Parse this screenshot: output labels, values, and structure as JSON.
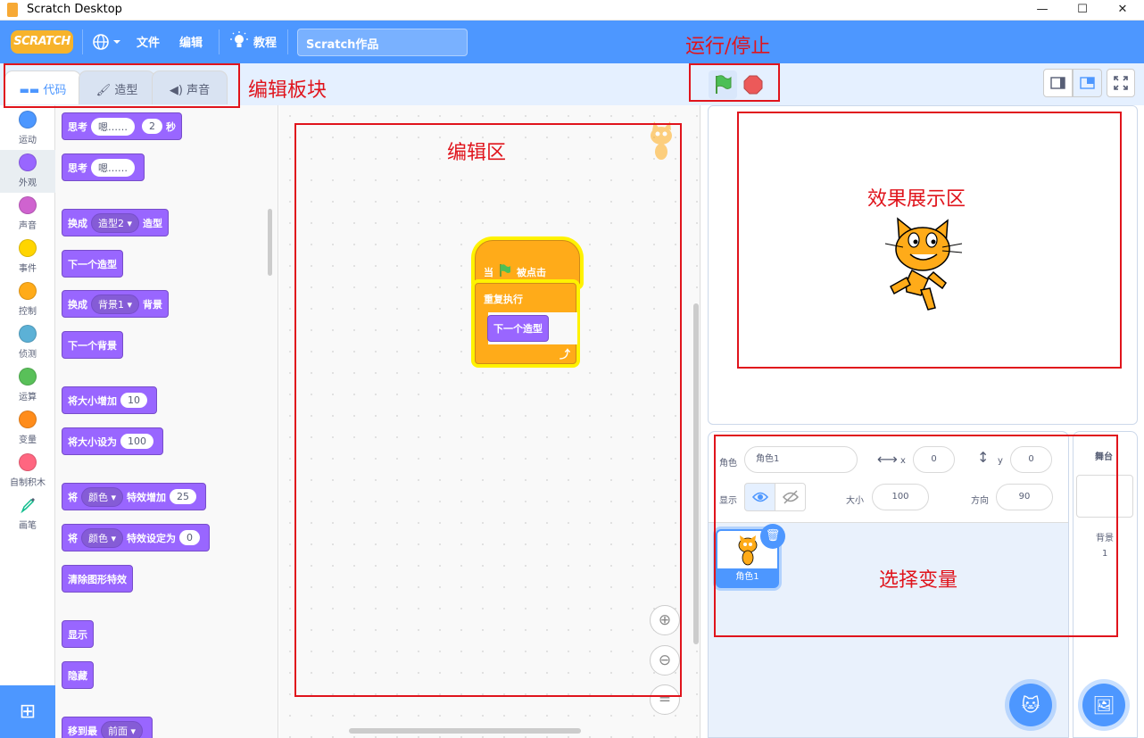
{
  "window": {
    "title": "Scratch Desktop",
    "minimize": "—",
    "maximize": "☐",
    "close": "✕"
  },
  "menubar": {
    "logo": "SCRATCH",
    "file": "文件",
    "edit": "编辑",
    "tutorials": "教程",
    "project_title": "Scratch作品"
  },
  "tabs": {
    "code": "代码",
    "costumes": "造型",
    "sounds": "声音"
  },
  "categories": [
    {
      "label": "运动",
      "color": "#4c97ff"
    },
    {
      "label": "外观",
      "color": "#9966ff"
    },
    {
      "label": "声音",
      "color": "#cf63cf"
    },
    {
      "label": "事件",
      "color": "#ffd500"
    },
    {
      "label": "控制",
      "color": "#ffab19"
    },
    {
      "label": "侦测",
      "color": "#5cb1d6"
    },
    {
      "label": "运算",
      "color": "#59c059"
    },
    {
      "label": "变量",
      "color": "#ff8c1a"
    },
    {
      "label": "自制积木",
      "color": "#ff6680"
    },
    {
      "label": "画笔",
      "color": "#0fbd8c"
    }
  ],
  "palette": {
    "think_for": {
      "a": "思考",
      "v1": "嗯……",
      "v2": "2",
      "b": "秒"
    },
    "think": {
      "a": "思考",
      "v1": "嗯……"
    },
    "switch_costume": {
      "a": "换成",
      "v1": "造型2 ▾",
      "b": "造型"
    },
    "next_costume": "下一个造型",
    "switch_backdrop": {
      "a": "换成",
      "v1": "背景1 ▾",
      "b": "背景"
    },
    "next_backdrop": "下一个背景",
    "change_size": {
      "a": "将大小增加",
      "v1": "10"
    },
    "set_size": {
      "a": "将大小设为",
      "v1": "100"
    },
    "change_effect": {
      "a": "将",
      "v1": "颜色 ▾",
      "b": "特效增加",
      "v2": "25"
    },
    "set_effect": {
      "a": "将",
      "v1": "颜色 ▾",
      "b": "特效设定为",
      "v2": "0"
    },
    "clear_effects": "清除图形特效",
    "show": "显示",
    "hide": "隐藏",
    "go_to_layer": {
      "a": "移到最",
      "v1": "前面 ▾"
    }
  },
  "script": {
    "hat_a": "当",
    "hat_b": "被点击",
    "forever": "重复执行",
    "next_costume": "下一个造型",
    "loop_arrow": "⤴"
  },
  "zoom": {
    "in": "⊕",
    "out": "⊖",
    "reset": "="
  },
  "sprite_info": {
    "sprite_label": "角色",
    "sprite_name": "角色1",
    "x_label": "x",
    "x_value": "0",
    "y_label": "y",
    "y_value": "0",
    "show_label": "显示",
    "size_label": "大小",
    "size_value": "100",
    "direction_label": "方向",
    "direction_value": "90"
  },
  "sprite_tile": {
    "name": "角色1"
  },
  "stage_panel": {
    "title": "舞台",
    "backdrops_label": "背景",
    "backdrops_count": "1"
  },
  "annotations": {
    "run_stop": "运行/停止",
    "edit_blocks": "编辑板块",
    "edit_area": "编辑区",
    "display_area": "效果展示区",
    "select_var": "选择变量"
  }
}
